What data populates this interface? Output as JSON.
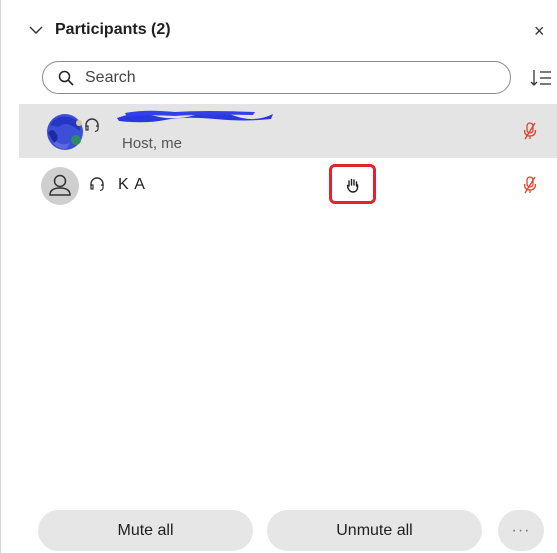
{
  "panel": {
    "title": "Participants (2)",
    "collapse_icon": "chevron-down-icon",
    "close_label": "×"
  },
  "search": {
    "placeholder": "Search",
    "value": "",
    "icon": "search-icon"
  },
  "sort": {
    "icon": "sort-list-icon"
  },
  "participants": [
    {
      "name": "",
      "name_redacted": true,
      "subtitle": "Host, me",
      "avatar": "photo",
      "audio": "headset-icon",
      "mic": "mic-muted-icon",
      "selected": true
    },
    {
      "name": "K A",
      "subtitle": "",
      "avatar": "generic-person-icon",
      "audio": "headset-icon",
      "mic": "mic-muted-icon",
      "hand_raised": true
    }
  ],
  "footer": {
    "mute_all_label": "Mute all",
    "unmute_all_label": "Unmute all",
    "more_label": "···"
  },
  "colors": {
    "selected_row": "#e4e4e4",
    "muted_mic": "#e0442f",
    "highlight_box": "#e0232e",
    "pill_button": "#e6e6e6"
  }
}
